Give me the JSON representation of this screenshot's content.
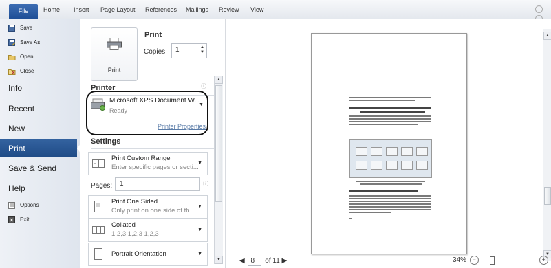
{
  "ribbon": {
    "file": "File",
    "tabs": [
      "Home",
      "Insert",
      "Page Layout",
      "References",
      "Mailings",
      "Review",
      "View"
    ]
  },
  "nav": {
    "quick": [
      "Save",
      "Save As",
      "Open",
      "Close"
    ],
    "items": [
      "Info",
      "Recent",
      "New",
      "Print",
      "Save & Send",
      "Help"
    ],
    "bottom": [
      "Options",
      "Exit"
    ]
  },
  "print": {
    "title": "Print",
    "button_label": "Print",
    "copies_label": "Copies:",
    "copies_value": "1"
  },
  "printer": {
    "heading": "Printer",
    "name": "Microsoft XPS Document W...",
    "status": "Ready",
    "properties_link": "Printer Properties"
  },
  "settings": {
    "heading": "Settings",
    "range_title": "Print Custom Range",
    "range_sub": "Enter specific pages or secti...",
    "pages_label": "Pages:",
    "pages_value": "1",
    "sided_title": "Print One Sided",
    "sided_sub": "Only print on one side of th...",
    "collate_title": "Collated",
    "collate_sub": "1,2,3   1,2,3   1,2,3",
    "orientation_title": "Portrait Orientation"
  },
  "preview": {
    "page_current": "8",
    "page_total_label": "of 11",
    "zoom": "34%"
  },
  "colors": {
    "accent": "#1f4b86",
    "file_tab": "#2b5ea8",
    "link": "#5a7ca8"
  }
}
